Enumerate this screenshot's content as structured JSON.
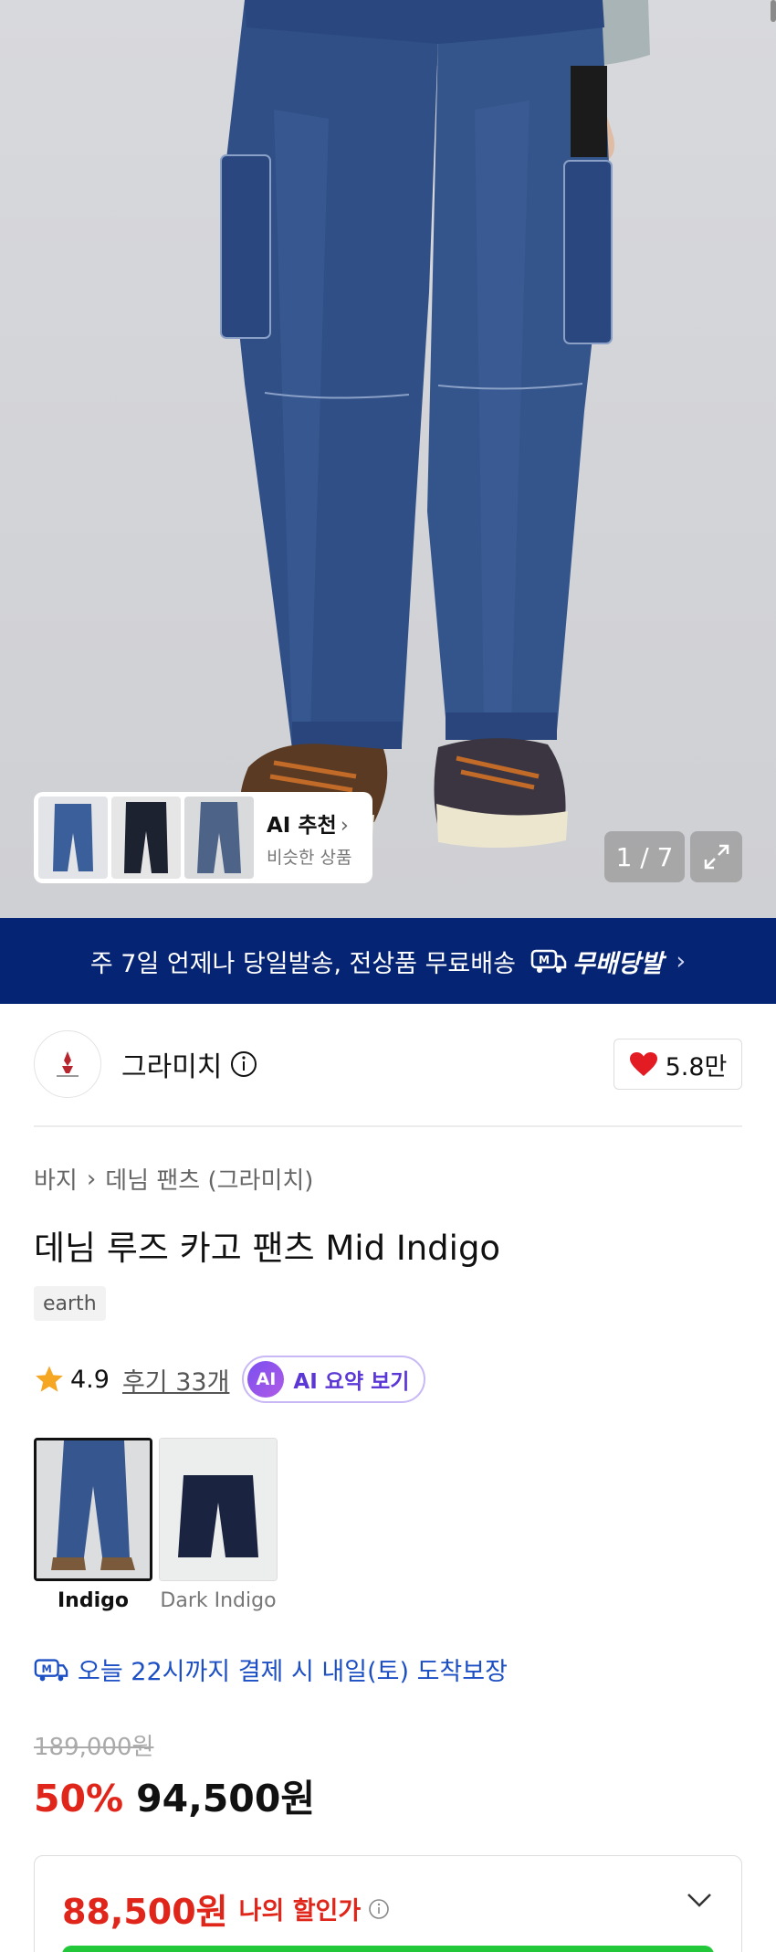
{
  "hero": {
    "ai_card": {
      "title": "AI 추천",
      "subtitle": "비슷한 상품"
    },
    "pager": "1 / 7"
  },
  "banner": {
    "text": "주 7일 언제나 당일발송, 전상품 무료배송",
    "badge_text": "무배당발"
  },
  "brand": {
    "name": "그라미치",
    "likes": "5.8만"
  },
  "product": {
    "breadcrumb": [
      "바지",
      "데님 팬츠 (그라미치)"
    ],
    "title": "데님 루즈 카고 팬츠 Mid Indigo",
    "tag": "earth",
    "rating": "4.9",
    "reviews": "후기 33개",
    "ai_summary": "AI 요약 보기",
    "ai_badge": "AI",
    "colors": [
      {
        "label": "Indigo",
        "selected": true
      },
      {
        "label": "Dark Indigo",
        "selected": false
      }
    ],
    "delivery": "오늘 22시까지 결제 시 내일(토) 도착보장",
    "original_price": "189,000원",
    "discount": "50%",
    "price": "94,500원",
    "my_price": "88,500원",
    "my_price_label": "나의 할인가"
  },
  "colors": {
    "banner_bg": "#062474",
    "sale_red": "#e0261a",
    "delivery_blue": "#1d4fc4",
    "ai_purple": "#5b37d6",
    "cta_green": "#22c83a"
  },
  "icons": [
    "heart-icon",
    "info-icon",
    "star-icon",
    "truck-icon",
    "expand-icon",
    "chevron-down-icon",
    "chevron-right-icon"
  ]
}
